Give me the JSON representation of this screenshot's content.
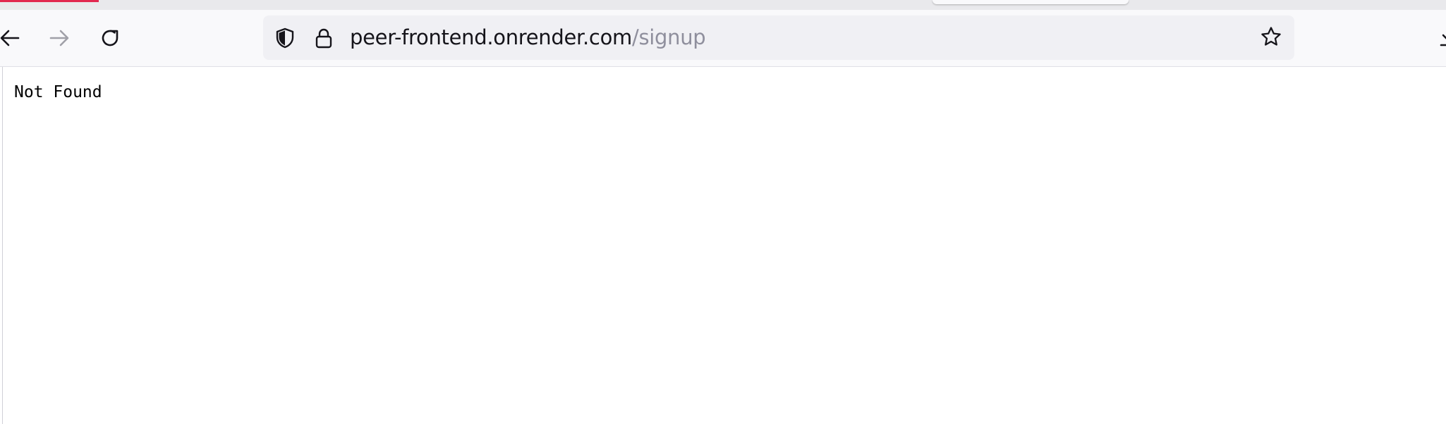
{
  "browser": {
    "url_host": "peer-frontend.onrender.com",
    "url_path": "/signup",
    "colors": {
      "tab_accent": "#e22850",
      "icon": "#15141a",
      "icon_disabled": "#a0a0a8"
    },
    "icons": {
      "back": "arrow-left",
      "forward": "arrow-right",
      "reload": "reload",
      "tracking_protection": "shield",
      "secure": "lock",
      "bookmark": "star",
      "downloads": "download"
    }
  },
  "page": {
    "body_text": "Not Found"
  }
}
